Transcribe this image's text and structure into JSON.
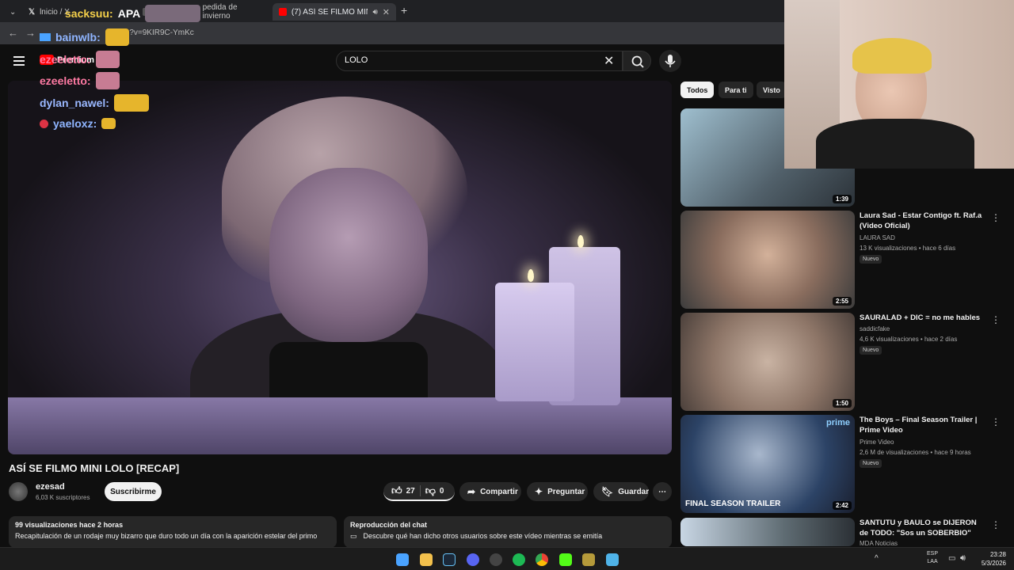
{
  "browser": {
    "tabs": [
      {
        "label": "lnicio / X"
      },
      {
        "label": "pedida de invierno"
      },
      {
        "label": "(7) ASÍ SE FILMO MINI LOLO"
      }
    ],
    "url": "tch?v=9KIR9C-YmKc"
  },
  "youtube": {
    "premium_label": "Premium",
    "search_value": "LOLO"
  },
  "stream_chat": [
    {
      "user": "sacksuu:",
      "text": "APA",
      "color": "#f5d04a"
    },
    {
      "user": "bainwlb:",
      "text": "",
      "color": "#8fb5ff"
    },
    {
      "user": "ezeeletto:",
      "text": "",
      "color": "#ff7aa3"
    },
    {
      "user": "ezeeletto:",
      "text": "",
      "color": "#ff7aa3"
    },
    {
      "user": "dylan_nawel:",
      "text": "",
      "color": "#9ab8ff"
    },
    {
      "user": "yaeloxz:",
      "text": "",
      "color": "#8fb5ff"
    }
  ],
  "video": {
    "title": "ASÍ SE FILMO MINI LOLO [RECAP]",
    "channel": "ezesad",
    "subscribers": "6,03 K suscriptores",
    "subscribe_label": "Suscribirme",
    "likes": "27",
    "dislikes": "0",
    "share_label": "Compartir",
    "ask_label": "Preguntar",
    "save_label": "Guardar",
    "views": "99 visualizaciones  hace 2 horas",
    "description": "Recapitulación de un rodaje muy bizarro que duro todo un día con la aparición estelar del primo",
    "chat_replay_title": "Reproducción del chat",
    "chat_replay_text": "Descubre qué han dicho otros usuarios sobre este vídeo mientras se emitía"
  },
  "filters": [
    "Todos",
    "Para ti",
    "Visto"
  ],
  "recommendations": [
    {
      "title": "",
      "channel": "",
      "meta": "",
      "badge": "",
      "duration": "1:39"
    },
    {
      "title": "Laura Sad - Estar Contigo ft. Raf.a (Video Oficial)",
      "channel": "LAURA SAD",
      "meta": "13 K visualizaciones • hace 6 días",
      "badge": "Nuevo",
      "duration": "2:55"
    },
    {
      "title": "SAURALAD + DIC = no me hables",
      "channel": "saddicfake",
      "meta": "4,6 K visualizaciones • hace 2 días",
      "badge": "Nuevo",
      "duration": "1:50"
    },
    {
      "title": "The Boys – Final Season Trailer | Prime Video",
      "channel": "Prime Video",
      "meta": "2,6 M de visualizaciones • hace 9 horas",
      "badge": "Nuevo",
      "duration": "2:42",
      "thumb_text": "FINAL SEASON TRAILER",
      "thumb_brand": "prime"
    },
    {
      "title": "SANTUTU y BAULO se DIJERON de TODO: \"Sos un SOBERBIO\"",
      "channel": "MDA Noticias",
      "meta": "",
      "badge": "",
      "duration": ""
    }
  ],
  "taskbar": {
    "lang": "ESP",
    "layout": "LAA",
    "time": "23:28",
    "date": "5/3/2026"
  }
}
